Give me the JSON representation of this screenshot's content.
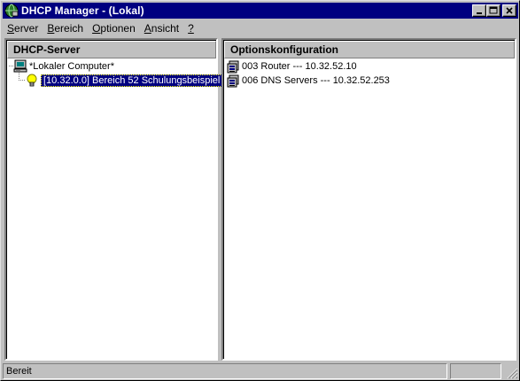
{
  "window": {
    "title": "DHCP Manager - (Lokal)",
    "buttons": {
      "minimize_icon": "minimize-icon",
      "maximize_icon": "maximize-icon",
      "close_icon": "close-icon"
    }
  },
  "menu": [
    {
      "underlined": "S",
      "rest": "erver"
    },
    {
      "underlined": "B",
      "rest": "ereich"
    },
    {
      "underlined": "O",
      "rest": "ptionen"
    },
    {
      "underlined": "A",
      "rest": "nsicht"
    },
    {
      "underlined": "?",
      "rest": ""
    }
  ],
  "left_pane": {
    "header": "DHCP-Server",
    "tree": {
      "root_label": "*Lokaler Computer*",
      "root_icon": "computer-icon",
      "child_label": "[10.32.0.0] Bereich 52 Schulungsbeispiel",
      "child_icon": "lightbulb-icon"
    }
  },
  "right_pane": {
    "header": "Optionskonfiguration",
    "options": [
      {
        "text": "003  Router --- 10.32.52.10",
        "icon": "option-icon"
      },
      {
        "text": "006  DNS Servers --- 10.32.52.253",
        "icon": "option-icon"
      }
    ]
  },
  "status": {
    "text": "Bereit"
  },
  "colors": {
    "titlebar": "#000080",
    "face": "#c0c0c0",
    "selection": "#000080",
    "bulb": "#ffff00"
  }
}
